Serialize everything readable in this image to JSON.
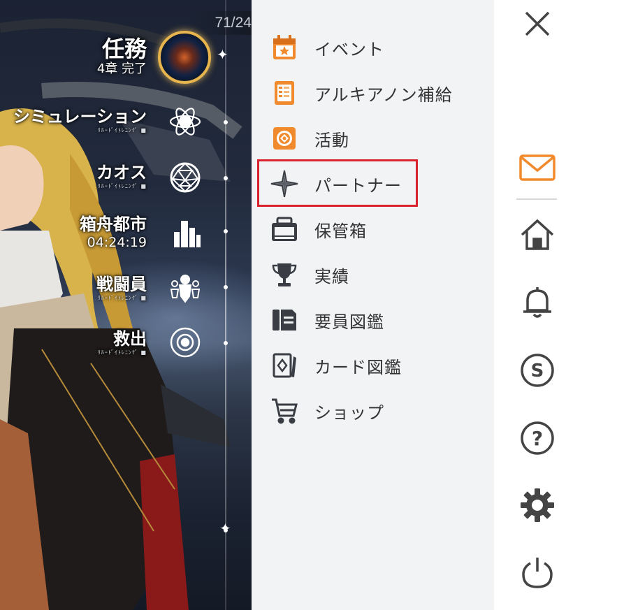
{
  "scene": {
    "counter": "71/24",
    "mission": {
      "title": "任務",
      "subtitle": "4章 完了"
    },
    "nav": [
      {
        "label": "シミュレーション",
        "tag": "ﾘﾙｰﾄﾞｲﾄﾚﾆﾝｸﾞ ■",
        "icon": "atom-icon"
      },
      {
        "label": "カオス",
        "tag": "ﾘﾙｰﾄﾞｲﾄﾚﾆﾝｸﾞ ■",
        "icon": "geodesic-sphere-icon"
      },
      {
        "label": "箱舟都市",
        "sublabel": "04:24:19",
        "icon": "city-buildings-icon"
      },
      {
        "label": "戦闘員",
        "tag": "ﾘﾙｰﾄﾞｲﾄﾚﾆﾝｸﾞ ■",
        "icon": "squad-figures-icon"
      },
      {
        "label": "救出",
        "tag": "ﾘﾙｰﾄﾞｲﾄﾚﾆﾝｸﾞ ■",
        "icon": "target-circle-icon"
      }
    ]
  },
  "menu": {
    "items": [
      {
        "label": "イベント",
        "icon": "event-calendar-icon"
      },
      {
        "label": "アルキアノン補給",
        "icon": "supply-card-icon"
      },
      {
        "label": "活動",
        "icon": "activity-badge-icon"
      },
      {
        "label": "パートナー",
        "icon": "partner-sparkle-icon"
      },
      {
        "label": "保管箱",
        "icon": "storage-box-icon"
      },
      {
        "label": "実績",
        "icon": "trophy-icon"
      },
      {
        "label": "要員図鑑",
        "icon": "personnel-files-icon"
      },
      {
        "label": "カード図鑑",
        "icon": "card-album-icon"
      },
      {
        "label": "ショップ",
        "icon": "shopping-cart-icon"
      }
    ],
    "highlighted": "パートナー"
  },
  "toolbar": {
    "items": [
      "close-icon",
      "mail-icon",
      "home-icon",
      "bell-icon",
      "s-coin-icon",
      "help-icon",
      "settings-gear-icon",
      "power-icon"
    ]
  },
  "colors": {
    "accent_orange": "#f08a2c",
    "highlight_red": "#d9222d",
    "menu_bg": "#f2f3f5"
  }
}
